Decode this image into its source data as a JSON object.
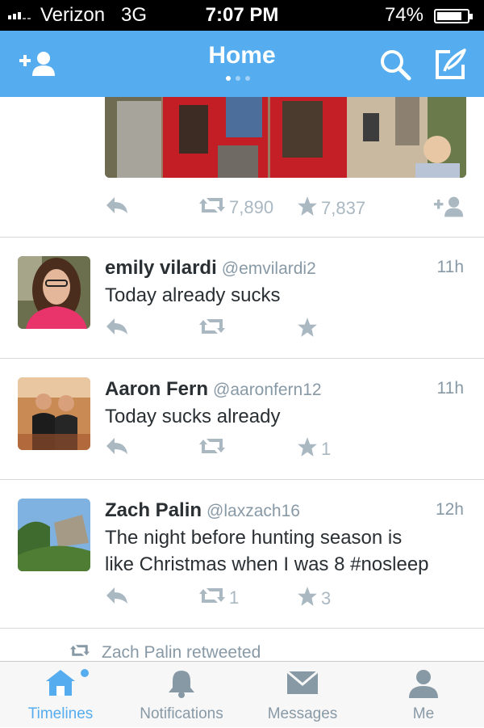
{
  "status_bar": {
    "carrier": "Verizon",
    "network": "3G",
    "time": "7:07 PM",
    "battery": "74%"
  },
  "nav": {
    "title": "Home",
    "add_user_icon": "add-user-icon",
    "search_icon": "search-icon",
    "compose_icon": "compose-tweet-icon",
    "page_count": 3,
    "active_page": 1
  },
  "top_tweet": {
    "retweets": "7,890",
    "favorites": "7,837"
  },
  "tweets": [
    {
      "name": "emily vilardi",
      "handle": "@emvilardi2",
      "time": "11h",
      "text": "Today already sucks",
      "retweets": "",
      "favorites": ""
    },
    {
      "name": "Aaron Fern",
      "handle": "@aaronfern12",
      "time": "11h",
      "text": "Today sucks already",
      "retweets": "",
      "favorites": "1"
    },
    {
      "name": "Zach Palin",
      "handle": "@laxzach16",
      "time": "12h",
      "text_line1": "The night before hunting season is",
      "text_line2": "like Christmas when I was 8 #nosleep",
      "retweets": "1",
      "favorites": "3"
    }
  ],
  "retweet_note": "Zach Palin retweeted",
  "tabs": [
    {
      "label": "Timelines",
      "icon": "home-icon",
      "active": true
    },
    {
      "label": "Notifications",
      "icon": "bell-icon",
      "active": false
    },
    {
      "label": "Messages",
      "icon": "envelope-icon",
      "active": false
    },
    {
      "label": "Me",
      "icon": "person-icon",
      "active": false
    }
  ],
  "colors": {
    "brand": "#55acee",
    "action_gray": "#aab8c2",
    "text": "#292f33",
    "meta": "#8899a6"
  }
}
